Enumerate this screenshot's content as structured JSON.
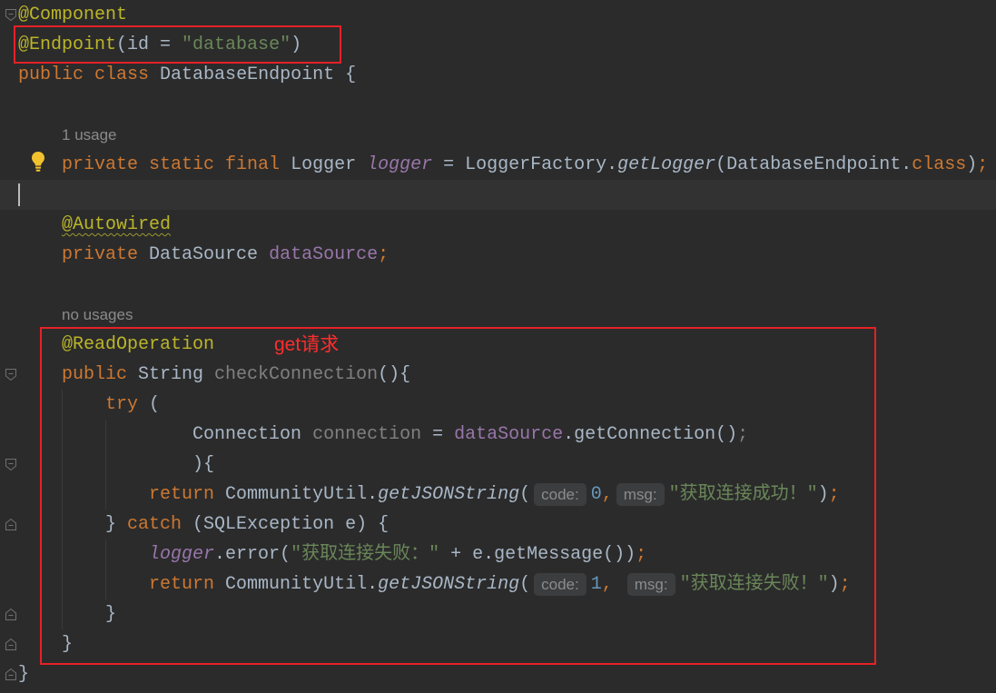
{
  "editor": {
    "background": "#2b2b2b",
    "text_color": "#a9b7c6",
    "current_line_color": "#323232",
    "caret_color": "#bbbbbb",
    "param_hint_color": "#8c8c8c",
    "param_hint_background": "#3b3d3f",
    "code_vision_color": "#8a8a8a",
    "gutter_icon_color": "#6e7073",
    "bulb_color": "#f2c12e",
    "warning_underline_color": "#9a9a2e",
    "lines": [
      {
        "gutter_icon": "fold-start-icon",
        "tokens": [
          {
            "text": "@Component",
            "color": "#bbb529"
          }
        ]
      },
      {
        "tokens": [
          {
            "text": "@Endpoint",
            "color": "#bbb529"
          },
          {
            "text": "(id = "
          },
          {
            "text": "\"database\"",
            "color": "#6a8759"
          },
          {
            "text": ")"
          }
        ]
      },
      {
        "tokens": [
          {
            "text": "public",
            "color": "#cc7832"
          },
          {
            "text": " "
          },
          {
            "text": "class",
            "color": "#cc7832"
          },
          {
            "text": " DatabaseEndpoint {"
          }
        ]
      },
      {
        "tokens": []
      },
      {
        "tokens": [
          {
            "text": "    "
          },
          {
            "text": "1 usage",
            "code_vision": true
          }
        ]
      },
      {
        "gutter_icon": "bulb-icon",
        "tokens": [
          {
            "text": "    "
          },
          {
            "text": "private static final",
            "color": "#cc7832"
          },
          {
            "text": " Logger "
          },
          {
            "text": "logger",
            "color": "#9876aa",
            "italic": true
          },
          {
            "text": " = LoggerFactory."
          },
          {
            "text": "getLogger",
            "italic": true
          },
          {
            "text": "(DatabaseEndpoint."
          },
          {
            "text": "class",
            "color": "#cc7832"
          },
          {
            "text": ")"
          },
          {
            "text": ";",
            "color": "#cc7832"
          }
        ]
      },
      {
        "current": true,
        "caret": true,
        "tokens": []
      },
      {
        "tokens": [
          {
            "text": "    "
          },
          {
            "text": "@Autowired",
            "color": "#bbb529",
            "warning_underline": true
          }
        ]
      },
      {
        "tokens": [
          {
            "text": "    "
          },
          {
            "text": "private",
            "color": "#cc7832"
          },
          {
            "text": " DataSource "
          },
          {
            "text": "dataSource",
            "color": "#9876aa"
          },
          {
            "text": ";",
            "color": "#cc7832"
          }
        ]
      },
      {
        "tokens": []
      },
      {
        "tokens": [
          {
            "text": "    "
          },
          {
            "text": "no usages",
            "code_vision": true
          }
        ]
      },
      {
        "tokens": [
          {
            "text": "    "
          },
          {
            "text": "@ReadOperation",
            "color": "#bbb529"
          }
        ]
      },
      {
        "gutter_icon": "fold-start-icon",
        "tokens": [
          {
            "text": "    "
          },
          {
            "text": "public",
            "color": "#cc7832"
          },
          {
            "text": " String "
          },
          {
            "text": "checkConnection",
            "color": "#808080"
          },
          {
            "text": "(){"
          }
        ]
      },
      {
        "tokens": [
          {
            "text": "        "
          },
          {
            "text": "try",
            "color": "#cc7832"
          },
          {
            "text": " ("
          }
        ]
      },
      {
        "tokens": [
          {
            "text": "                Connection "
          },
          {
            "text": "connection",
            "color": "#808080"
          },
          {
            "text": " = "
          },
          {
            "text": "dataSource",
            "color": "#9876aa"
          },
          {
            "text": ".getConnection()"
          },
          {
            "text": ";",
            "color": "#808080"
          }
        ]
      },
      {
        "gutter_icon": "fold-start-icon",
        "tokens": [
          {
            "text": "                ){"
          }
        ]
      },
      {
        "tokens": [
          {
            "text": "            "
          },
          {
            "text": "return",
            "color": "#cc7832"
          },
          {
            "text": " CommunityUtil."
          },
          {
            "text": "getJSONString",
            "italic": true
          },
          {
            "text": "("
          },
          {
            "text": "code:",
            "param_hint": true
          },
          {
            "text": "0",
            "color": "#6897bb"
          },
          {
            "text": ",",
            "color": "#cc7832"
          },
          {
            "text": "msg:",
            "param_hint": true
          },
          {
            "text": "\"获取连接成功！\"",
            "color": "#6a8759"
          },
          {
            "text": ")"
          },
          {
            "text": ";",
            "color": "#cc7832"
          }
        ]
      },
      {
        "gutter_icon": "fold-end-icon",
        "tokens": [
          {
            "text": "        } "
          },
          {
            "text": "catch",
            "color": "#cc7832"
          },
          {
            "text": " (SQLException e) {"
          }
        ]
      },
      {
        "tokens": [
          {
            "text": "            "
          },
          {
            "text": "logger",
            "color": "#9876aa",
            "italic": true
          },
          {
            "text": ".error("
          },
          {
            "text": "\"获取连接失败：\"",
            "color": "#6a8759"
          },
          {
            "text": " + e.getMessage())"
          },
          {
            "text": ";",
            "color": "#cc7832"
          }
        ]
      },
      {
        "tokens": [
          {
            "text": "            "
          },
          {
            "text": "return",
            "color": "#cc7832"
          },
          {
            "text": " CommunityUtil."
          },
          {
            "text": "getJSONString",
            "italic": true
          },
          {
            "text": "("
          },
          {
            "text": "code:",
            "param_hint": true
          },
          {
            "text": "1",
            "color": "#6897bb"
          },
          {
            "text": ",",
            "color": "#cc7832"
          },
          {
            "text": " "
          },
          {
            "text": "msg:",
            "param_hint": true
          },
          {
            "text": "\"获取连接失败！\"",
            "color": "#6a8759"
          },
          {
            "text": ")"
          },
          {
            "text": ";",
            "color": "#cc7832"
          }
        ]
      },
      {
        "gutter_icon": "fold-end-icon",
        "tokens": [
          {
            "text": "        }"
          }
        ]
      },
      {
        "gutter_icon": "fold-end-icon",
        "tokens": [
          {
            "text": "    }"
          }
        ]
      },
      {
        "gutter_icon": "fold-end-icon",
        "tokens": [
          {
            "text": "}"
          }
        ]
      }
    ]
  },
  "markup": {
    "box_color": "#e52127",
    "callout_color": "#ff2d2d",
    "callout_text": "get请求"
  }
}
